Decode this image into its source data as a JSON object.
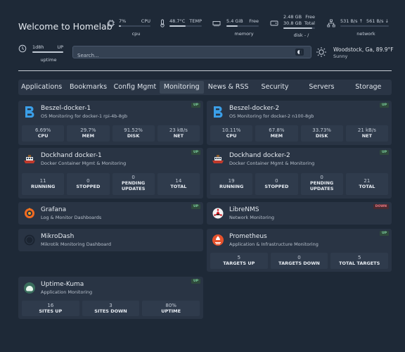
{
  "header": {
    "welcome": "Welcome to Homelab"
  },
  "resources": {
    "cpu": {
      "value": "7%",
      "name": "CPU",
      "label": "cpu",
      "fill": 0.07
    },
    "temp": {
      "value": "48.7°C",
      "name": "TEMP",
      "fill": 0.49
    },
    "memory": {
      "value": "5.4 GiB",
      "name": "Free",
      "label": "memory",
      "fill": 0.35
    },
    "disk": {
      "free_value": "2.48 GB",
      "free_name": "Free",
      "total_value": "30.8 GB",
      "total_name": "Total",
      "label": "disk - /",
      "fill": 0.92
    },
    "network": {
      "up": "531 B/s ↑",
      "down": "561 B/s ↓",
      "label": "network"
    },
    "uptime": {
      "value": "1d8h",
      "name": "UP",
      "label": "uptime"
    }
  },
  "search": {
    "placeholder": "Search..."
  },
  "weather": {
    "location": "Woodstock, Ga, 89.9°F",
    "condition": "Sunny"
  },
  "tabs": [
    "Applications",
    "Bookmarks",
    "Config Mgmt",
    "Monitoring",
    "News & RSS",
    "Security",
    "Servers",
    "Storage"
  ],
  "active_tab": "Monitoring",
  "cards": {
    "beszel1": {
      "title": "Beszel-docker-1",
      "sub": "OS Monitoring for docker-1 rpi-4b-8gb",
      "status": "UP",
      "stats": [
        {
          "v": "6.69%",
          "l": "CPU"
        },
        {
          "v": "29.7%",
          "l": "MEM"
        },
        {
          "v": "91.52%",
          "l": "DISK"
        },
        {
          "v": "23 kB/s",
          "l": "NET"
        }
      ]
    },
    "beszel2": {
      "title": "Beszel-docker-2",
      "sub": "OS Monitoring for docker-2 n100-8gb",
      "status": "UP",
      "stats": [
        {
          "v": "10.11%",
          "l": "CPU"
        },
        {
          "v": "67.8%",
          "l": "MEM"
        },
        {
          "v": "33.73%",
          "l": "DISK"
        },
        {
          "v": "21 kB/s",
          "l": "NET"
        }
      ]
    },
    "dockhand1": {
      "title": "Dockhand docker-1",
      "sub": "Docker Container Mgmt & Monitoring",
      "status": "UP",
      "stats": [
        {
          "v": "11",
          "l": "RUNNING"
        },
        {
          "v": "0",
          "l": "STOPPED"
        },
        {
          "v": "0",
          "l": "PENDING",
          "l2": "UPDATES"
        },
        {
          "v": "14",
          "l": "TOTAL"
        }
      ]
    },
    "dockhand2": {
      "title": "Dockhand docker-2",
      "sub": "Docker Container Mgmt & Monitoring",
      "status": "UP",
      "stats": [
        {
          "v": "19",
          "l": "RUNNING"
        },
        {
          "v": "0",
          "l": "STOPPED"
        },
        {
          "v": "0",
          "l": "PENDING",
          "l2": "UPDATES"
        },
        {
          "v": "21",
          "l": "TOTAL"
        }
      ]
    },
    "grafana": {
      "title": "Grafana",
      "sub": "Log & Monitor Dashboards",
      "status": "UP"
    },
    "librenms": {
      "title": "LibreNMS",
      "sub": "Network Monitoring",
      "status": "DOWN"
    },
    "mikrodash": {
      "title": "MikroDash",
      "sub": "Mikrotik Monitoring Dashboard"
    },
    "prometheus": {
      "title": "Prometheus",
      "sub": "Application & Infrastructure Monitoring",
      "status": "UP",
      "stats": [
        {
          "v": "5",
          "l": "TARGETS UP"
        },
        {
          "v": "0",
          "l": "TARGETS DOWN"
        },
        {
          "v": "5",
          "l": "TOTAL TARGETS"
        }
      ]
    },
    "uptimekuma": {
      "title": "Uptime-Kuma",
      "sub": "Application Monitoring",
      "status": "UP",
      "stats": [
        {
          "v": "16",
          "l": "SITES UP"
        },
        {
          "v": "3",
          "l": "SITES DOWN"
        },
        {
          "v": "80%",
          "l": "UPTIME"
        }
      ]
    }
  }
}
